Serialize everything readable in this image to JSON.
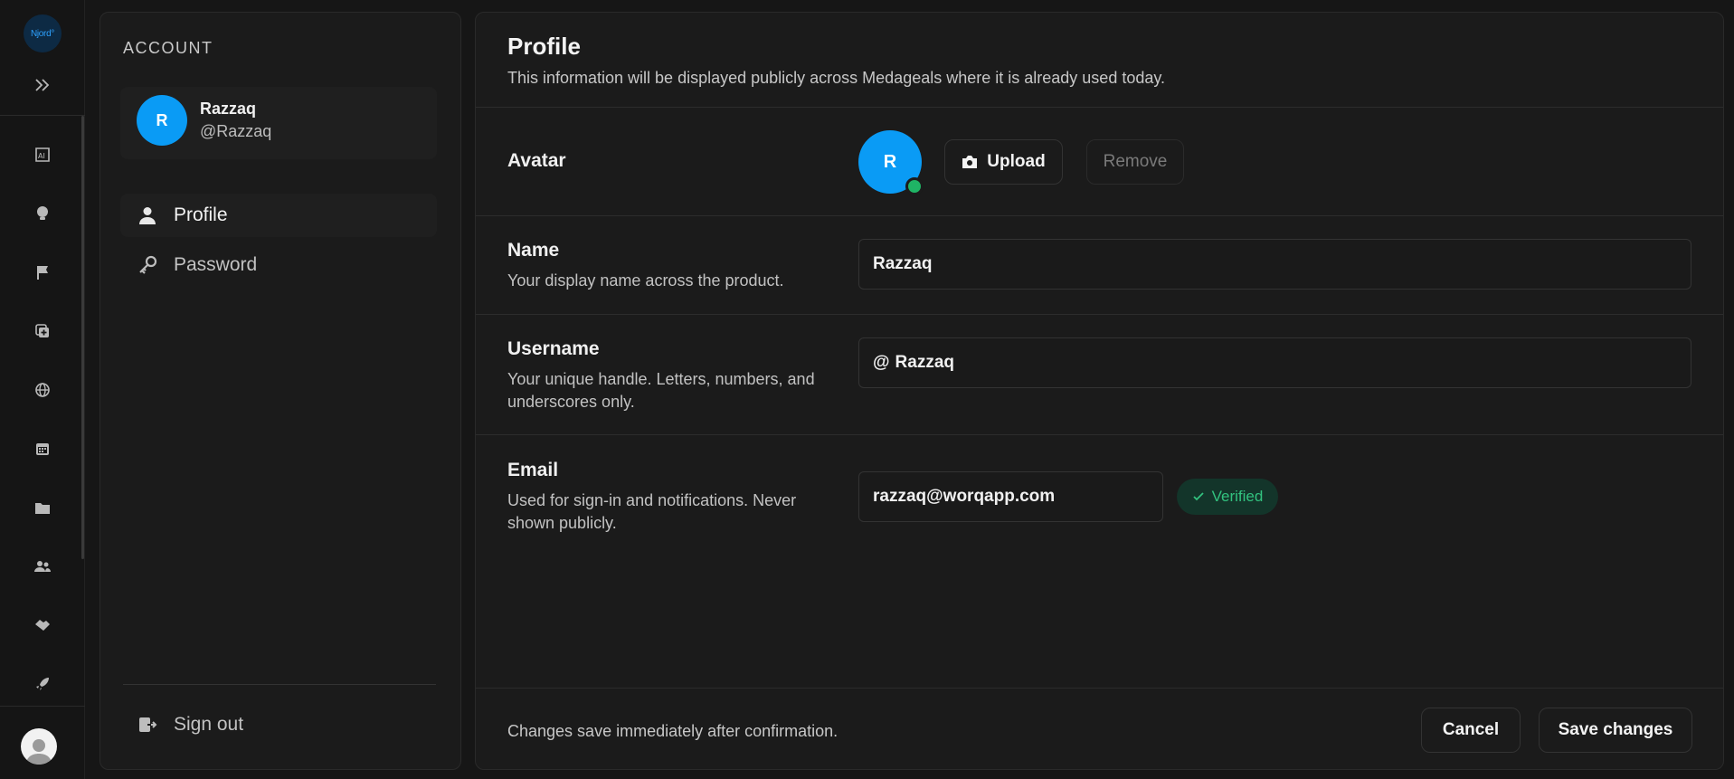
{
  "rail": {
    "logo_text": "Njord°",
    "items": [
      {
        "icon": "ai-text-icon"
      },
      {
        "icon": "lightbulb-icon"
      },
      {
        "icon": "flag-icon"
      },
      {
        "icon": "copy-plus-icon"
      },
      {
        "icon": "globe-icon"
      },
      {
        "icon": "calendar-icon"
      },
      {
        "icon": "folder-icon"
      },
      {
        "icon": "users-icon"
      },
      {
        "icon": "handshake-icon"
      },
      {
        "icon": "rocket-icon"
      }
    ]
  },
  "account": {
    "heading": "ACCOUNT",
    "user": {
      "initial": "R",
      "name": "Razzaq",
      "handle": "@Razzaq"
    },
    "nav": [
      {
        "label": "Profile",
        "icon": "person-icon",
        "active": true
      },
      {
        "label": "Password",
        "icon": "key-icon",
        "active": false
      }
    ],
    "sign_out": "Sign out"
  },
  "profile": {
    "title": "Profile",
    "subtitle": "This information will be displayed publicly across Medageals where it is already used today.",
    "avatar": {
      "label": "Avatar",
      "initial": "R",
      "upload": "Upload",
      "remove": "Remove",
      "status_color": "#1fb465"
    },
    "name": {
      "label": "Name",
      "help": "Your display name across the product.",
      "value": "Razzaq"
    },
    "username": {
      "label": "Username",
      "help": "Your unique handle. Letters, numbers, and underscores only.",
      "prefix": "@",
      "value": "Razzaq"
    },
    "email": {
      "label": "Email",
      "help": "Used for sign-in and notifications. Never shown publicly.",
      "value": "razzaq@worqapp.com",
      "badge": "Verified"
    },
    "footer": {
      "note": "Changes save immediately after confirmation.",
      "cancel": "Cancel",
      "save": "Save changes"
    }
  },
  "colors": {
    "accent": "#0a9bf5",
    "verified": "#32c27f",
    "background": "#161616"
  }
}
